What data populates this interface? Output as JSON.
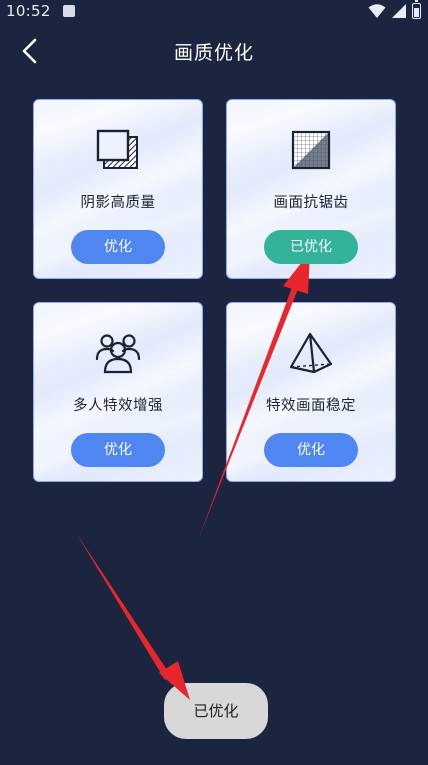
{
  "status_bar": {
    "time": "10:52",
    "icons": [
      "notification-icon",
      "wifi-icon",
      "signal-icon",
      "battery-icon"
    ]
  },
  "header": {
    "back_icon": "chevron-left-icon",
    "title": "画质优化"
  },
  "cards": [
    {
      "icon": "shadow-square-icon",
      "label": "阴影高质量",
      "button": "优化",
      "optimized": false
    },
    {
      "icon": "antialias-grid-icon",
      "label": "画面抗锯齿",
      "button": "已优化",
      "optimized": true
    },
    {
      "icon": "people-group-icon",
      "label": "多人特效增强",
      "button": "优化",
      "optimized": false
    },
    {
      "icon": "pyramid-icon",
      "label": "特效画面稳定",
      "button": "优化",
      "optimized": false
    }
  ],
  "toast": {
    "text": "已优化"
  },
  "colors": {
    "background": "#1b2540",
    "button_default": "#4f86f2",
    "button_done": "#33b49a",
    "card_border": "#8fa9f5",
    "arrow": "#e8262b"
  }
}
